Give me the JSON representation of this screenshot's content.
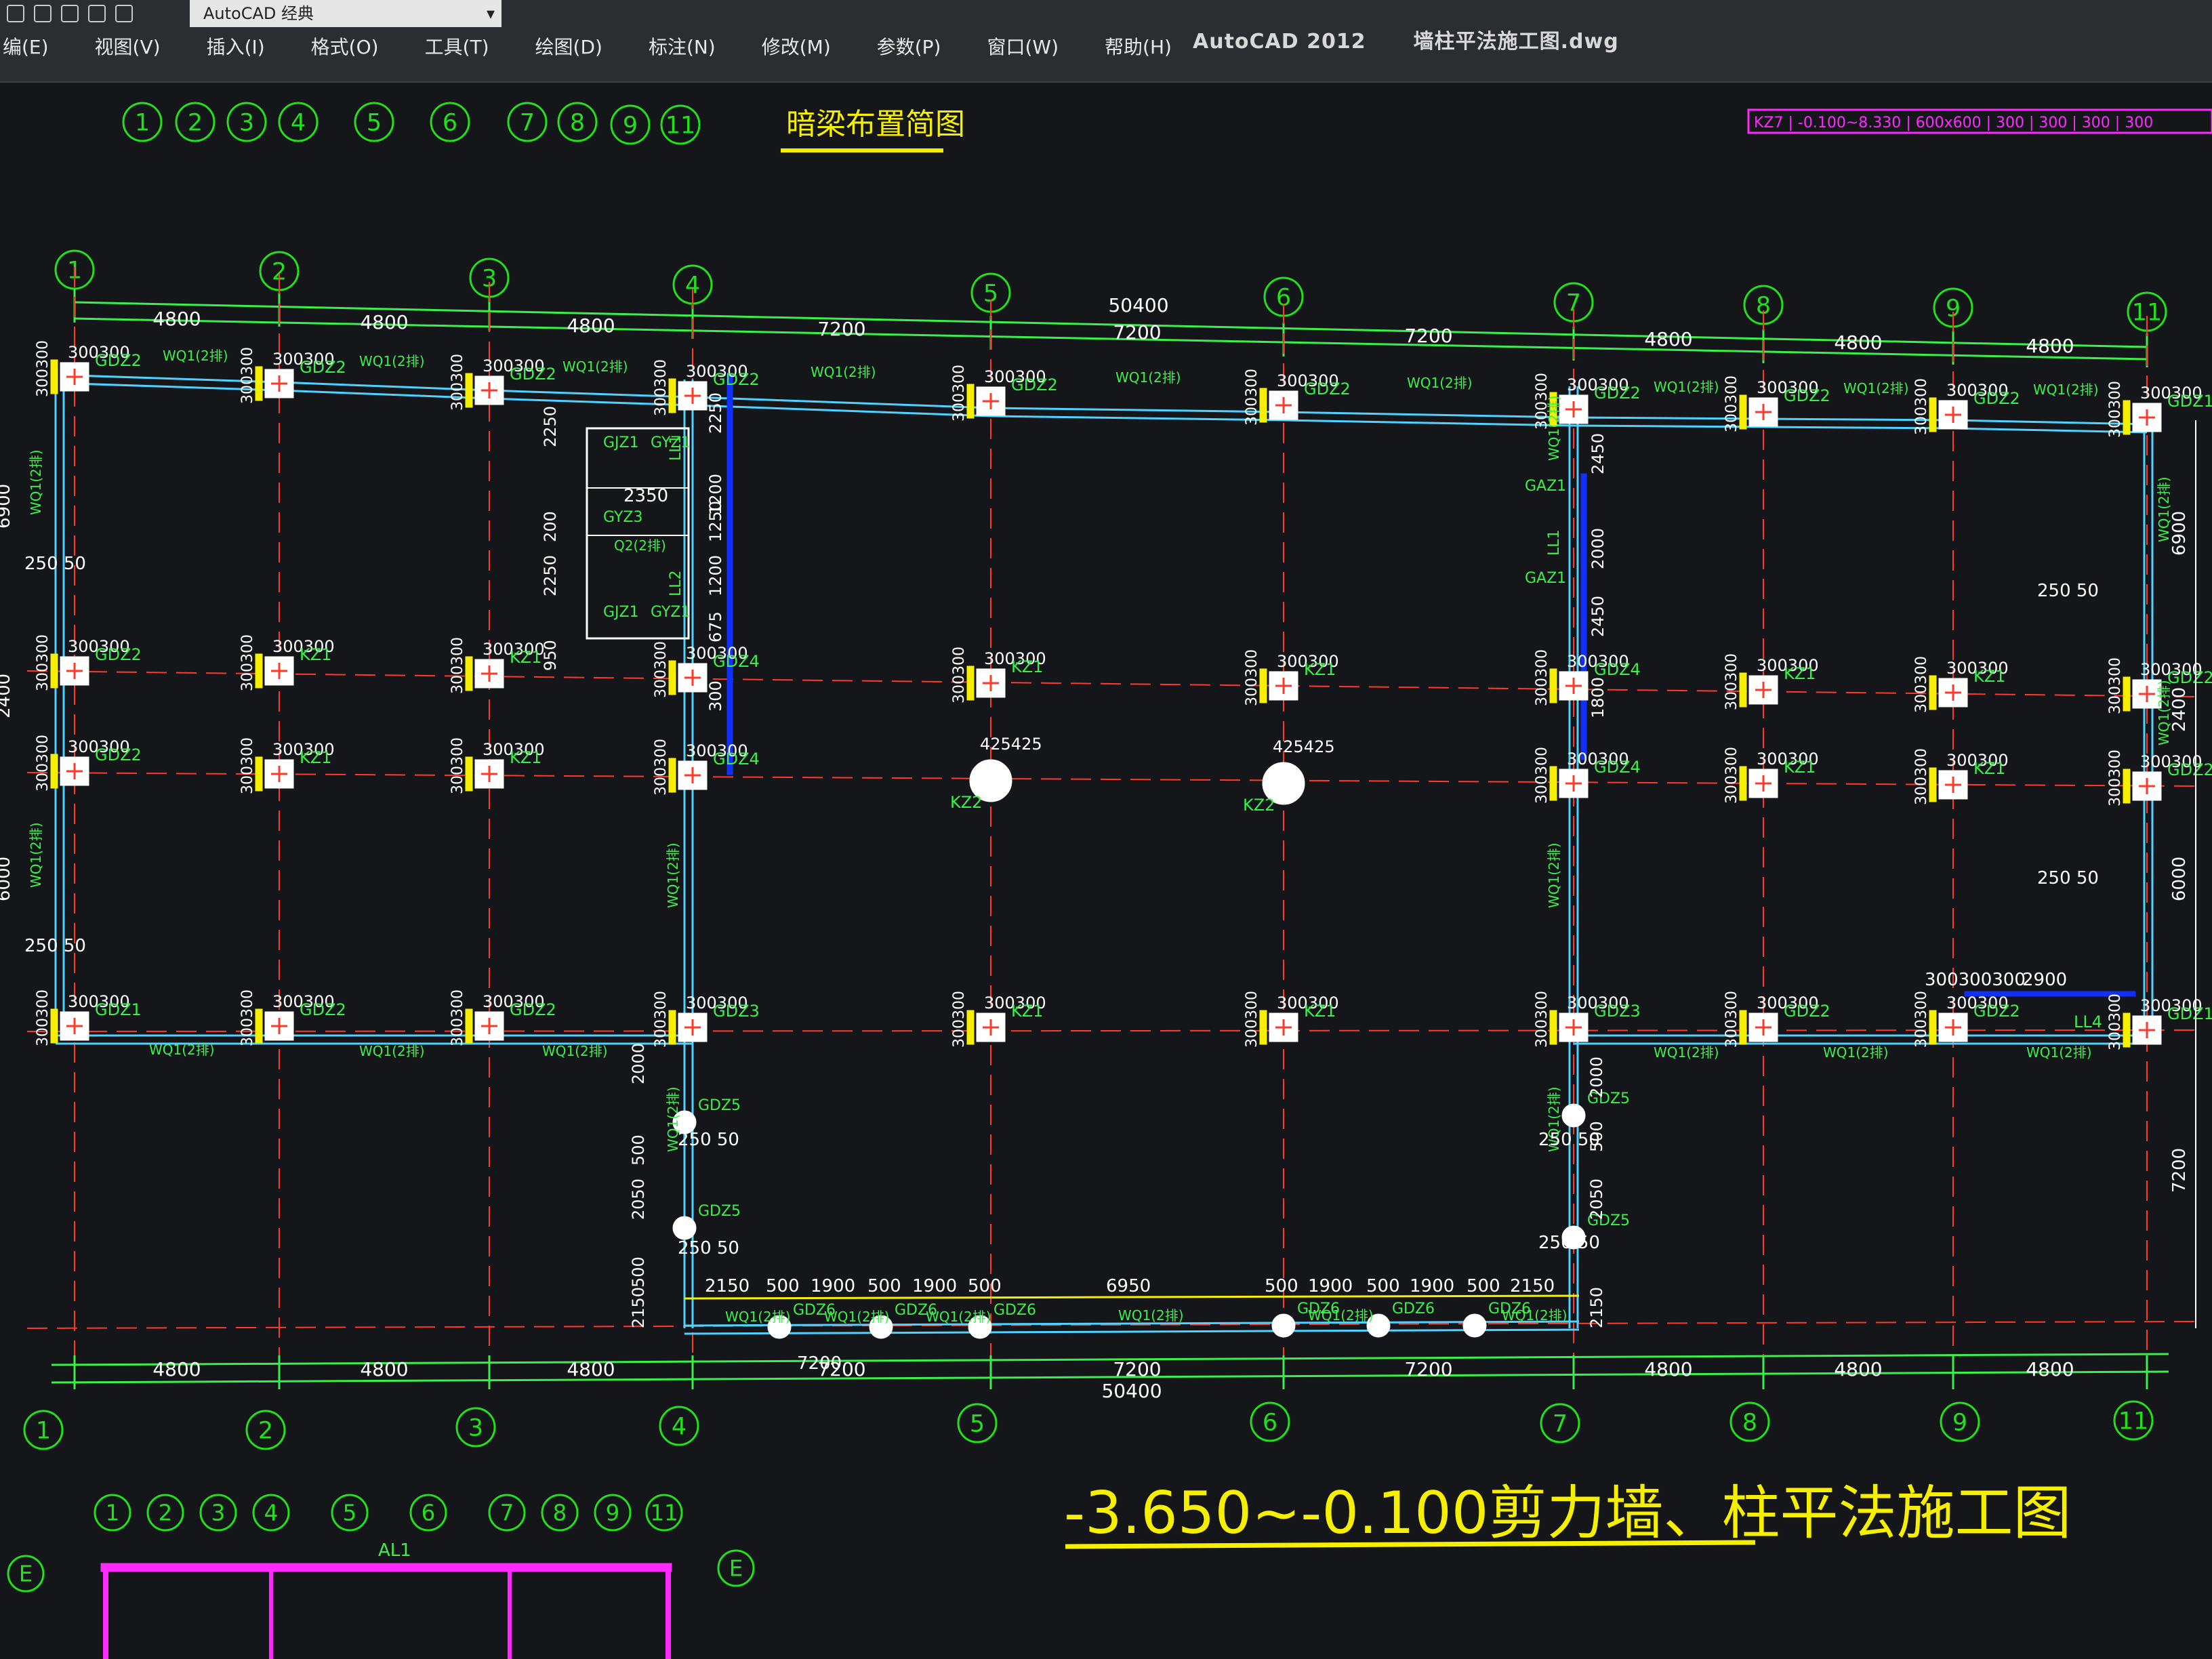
{
  "app": {
    "title": "AutoCAD 2012",
    "file": "墙柱平法施工图.dwg",
    "workspace": "AutoCAD 经典"
  },
  "menu": [
    "编(E)",
    "视图(V)",
    "插入(I)",
    "格式(O)",
    "工具(T)",
    "绘图(D)",
    "标注(N)",
    "修改(M)",
    "参数(P)",
    "窗口(W)",
    "帮助(H)"
  ],
  "colors": {
    "bg": "#14161a",
    "axis": "#22e01a",
    "wall": "#4fd2ff",
    "red": "#ff3a2a",
    "yellow": "#f6f000",
    "green": "#3cf04a",
    "white": "#ffffff",
    "blue": "#1030ff",
    "magenta": "#ff2aff"
  },
  "drawing": {
    "mini_title": "暗梁布置简图",
    "top_small_axes": [
      "1",
      "2",
      "3",
      "4",
      "5",
      "6",
      "7",
      "8",
      "9",
      "11"
    ],
    "axes": [
      "1",
      "2",
      "3",
      "4",
      "5",
      "6",
      "7",
      "8",
      "9",
      "11"
    ],
    "top_spacings": [
      "4800",
      "4800",
      "4800",
      "7200",
      "7200",
      "7200",
      "4800",
      "4800",
      "4800"
    ],
    "bottom_spacings": [
      "4800",
      "4800",
      "4800",
      "7200",
      "7200",
      "7200",
      "4800",
      "4800",
      "4800"
    ],
    "total": "50400",
    "right_dims": [
      "6900",
      "2400",
      "6000",
      "7200"
    ],
    "left_dims": [
      "6900",
      "2400",
      "6000"
    ],
    "main_title": "-3.650~-0.100剪力墙、柱平法施工图",
    "bottom_axes": [
      "1",
      "2",
      "3",
      "4",
      "5",
      "6",
      "7",
      "8",
      "9",
      "11"
    ],
    "axis_E": "E",
    "al": "AL1",
    "pink_table": "KZ7 | -0.100~8.330 | 600x600 | 300 | 300 | 300 | 300",
    "labels": {
      "kz1": "KZ1",
      "kz2": "KZ2",
      "gdz1": "GDZ1",
      "gdz2": "GDZ2",
      "gdz3": "GDZ3",
      "gdz4": "GDZ4",
      "gdz5": "GDZ5",
      "gdz6": "GDZ6",
      "gjz1": "GJZ1",
      "gyz1": "GYZ1",
      "gyz3": "GYZ3",
      "gaz1": "GAZ1",
      "wq1": "WQ1(2排)",
      "q2": "Q2(2排)",
      "ll1": "LL1",
      "ll2": "LL2",
      "ll4": "LL4",
      "d300": "300",
      "d300b": "300",
      "d250": "250",
      "d50": "50",
      "d425": "425",
      "d2350": "2350",
      "d1900": "1900",
      "d500": "500",
      "d2150": "2150",
      "d6950": "6950",
      "d2900": "2900",
      "d2000": "2000",
      "d2050": "2050",
      "d1200": "1200",
      "d1250": "1250",
      "d2250": "2250",
      "d2450": "2450",
      "d200": "200",
      "d950": "950",
      "d675": "675",
      "d1800": "1800"
    }
  }
}
